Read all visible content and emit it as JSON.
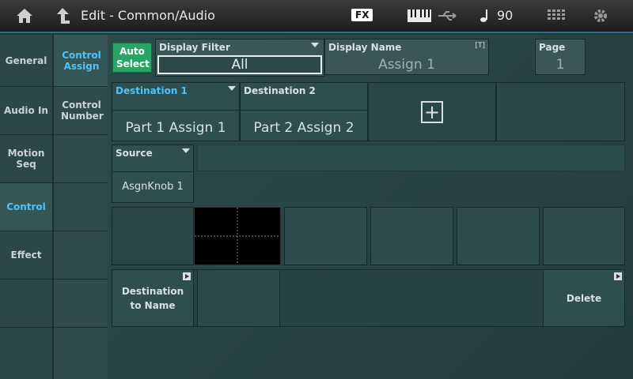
{
  "header": {
    "title": "Edit - Common/Audio",
    "fx_label": "FX",
    "tempo": "90"
  },
  "categories": [
    {
      "label": "General"
    },
    {
      "label": "Audio In"
    },
    {
      "label": "Motion Seq"
    },
    {
      "label": "Control"
    },
    {
      "label": "Effect"
    }
  ],
  "subtabs": [
    {
      "label": "Control Assign"
    },
    {
      "label": "Control Number"
    }
  ],
  "auto_select": {
    "label": "Auto Select"
  },
  "display_filter": {
    "label": "Display Filter",
    "value": "All"
  },
  "display_name": {
    "label": "Display Name",
    "value": "Assign 1",
    "badge": "[T]"
  },
  "page": {
    "label": "Page",
    "value": "1"
  },
  "destinations": [
    {
      "label": "Destination 1",
      "value": "Part 1 Assign 1"
    },
    {
      "label": "Destination 2",
      "value": "Part 2 Assign 2"
    }
  ],
  "add_symbol": "+",
  "source": {
    "label": "Source",
    "value": "AsgnKnob 1"
  },
  "dest_to_name": {
    "label": "Destination to Name"
  },
  "delete": {
    "label": "Delete"
  }
}
